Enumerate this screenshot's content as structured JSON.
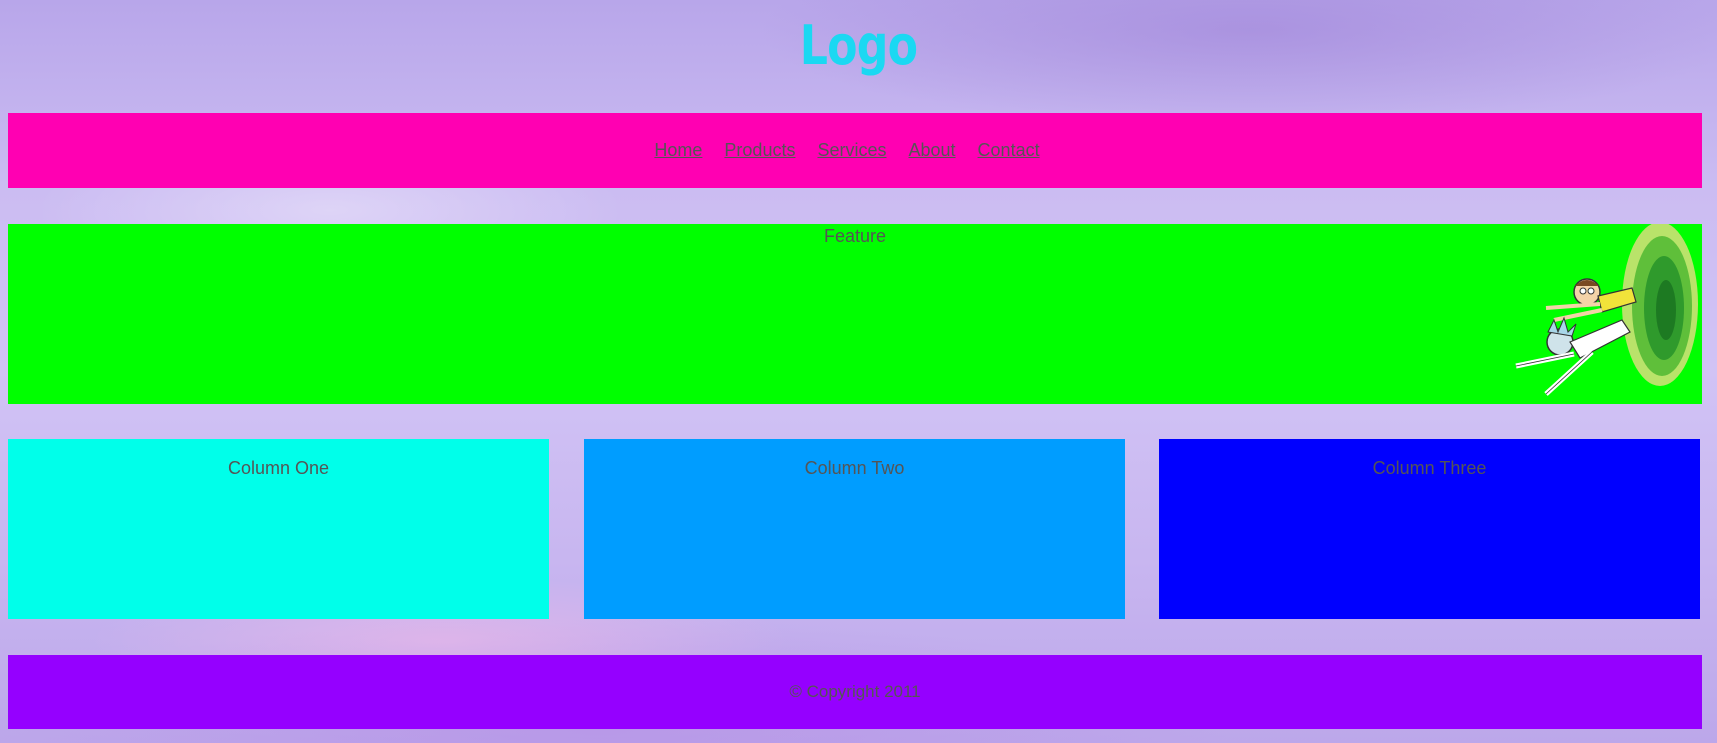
{
  "header": {
    "logo": "Logo"
  },
  "nav": {
    "items": [
      {
        "label": "Home"
      },
      {
        "label": "Products"
      },
      {
        "label": "Services"
      },
      {
        "label": "About"
      },
      {
        "label": "Contact"
      }
    ]
  },
  "feature": {
    "title": "Feature",
    "image_icon": "rick-and-morty-portal-illustration"
  },
  "columns": [
    {
      "title": "Column One",
      "color": "#00ffea"
    },
    {
      "title": "Column Two",
      "color": "#009dff"
    },
    {
      "title": "Column Three",
      "color": "#0000ff"
    }
  ],
  "footer": {
    "copyright": "© Copyright 2011"
  },
  "colors": {
    "logo": "#1bd8f2",
    "nav_bg": "#ff00b2",
    "feature_bg": "#00ff00",
    "footer_bg": "#9500ff",
    "text": "#555555"
  }
}
